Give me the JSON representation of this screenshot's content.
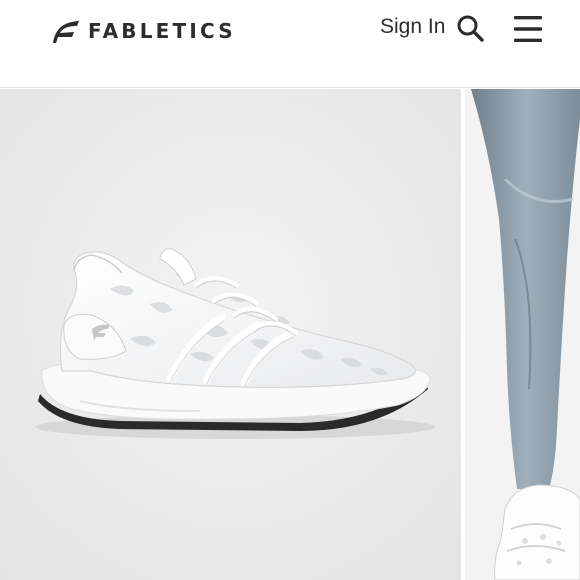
{
  "header": {
    "brand": "FABLETICS",
    "sign_in_label": "Sign In",
    "search_icon": "search-icon",
    "menu_icon": "hamburger-menu-icon"
  },
  "gallery": {
    "slides": [
      {
        "subject": "white knit sneaker"
      },
      {
        "subject": "grey leggings with white sneaker"
      }
    ]
  },
  "colors": {
    "text": "#2d2d2d",
    "slide_bg": "#ededed",
    "legging_grey": "#8a9aa6"
  }
}
